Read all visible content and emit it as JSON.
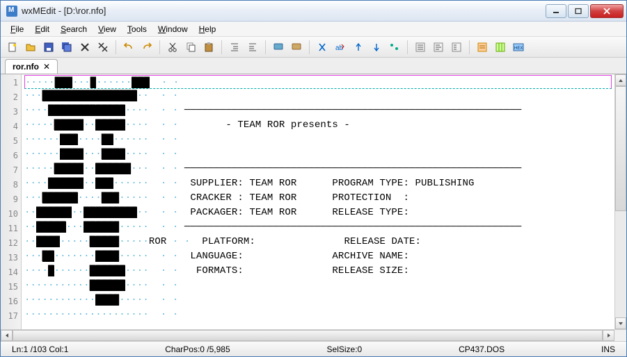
{
  "titlebar": {
    "title": "wxMEdit - [D:\\ror.nfo]"
  },
  "menubar": {
    "file": {
      "ul": "F",
      "rest": "ile"
    },
    "edit": {
      "ul": "E",
      "rest": "dit"
    },
    "search": {
      "ul": "S",
      "rest": "earch"
    },
    "view": {
      "ul": "V",
      "rest": "iew"
    },
    "tools": {
      "ul": "T",
      "rest": "ools"
    },
    "window": {
      "ul": "W",
      "rest": "indow"
    },
    "help": {
      "ul": "H",
      "rest": "elp"
    }
  },
  "tab": {
    "name": "ror.nfo"
  },
  "status": {
    "pos": "Ln:1 /103 Col:1",
    "charpos": "CharPos:0 /5,985",
    "selsize": "SelSize:0",
    "encoding": "CP437.DOS",
    "mode": "INS"
  },
  "nfo": {
    "banner": "- TEAM ROR presents -",
    "rows": [
      {
        "l": "SUPPLIER: TEAM ROR",
        "r": "PROGRAM TYPE: PUBLISHING"
      },
      {
        "l": "CRACKER : TEAM ROR",
        "r": "PROTECTION  :"
      },
      {
        "l": "PACKAGER: TEAM ROR",
        "r": "RELEASE TYPE:"
      },
      {
        "l": "PLATFORM:",
        "r": "RELEASE DATE:"
      },
      {
        "l": "LANGUAGE:",
        "r": "ARCHIVE NAME:"
      },
      {
        "l": " FORMATS:",
        "r": "RELEASE SIZE:"
      }
    ],
    "side": "ROR"
  },
  "lines": 17
}
